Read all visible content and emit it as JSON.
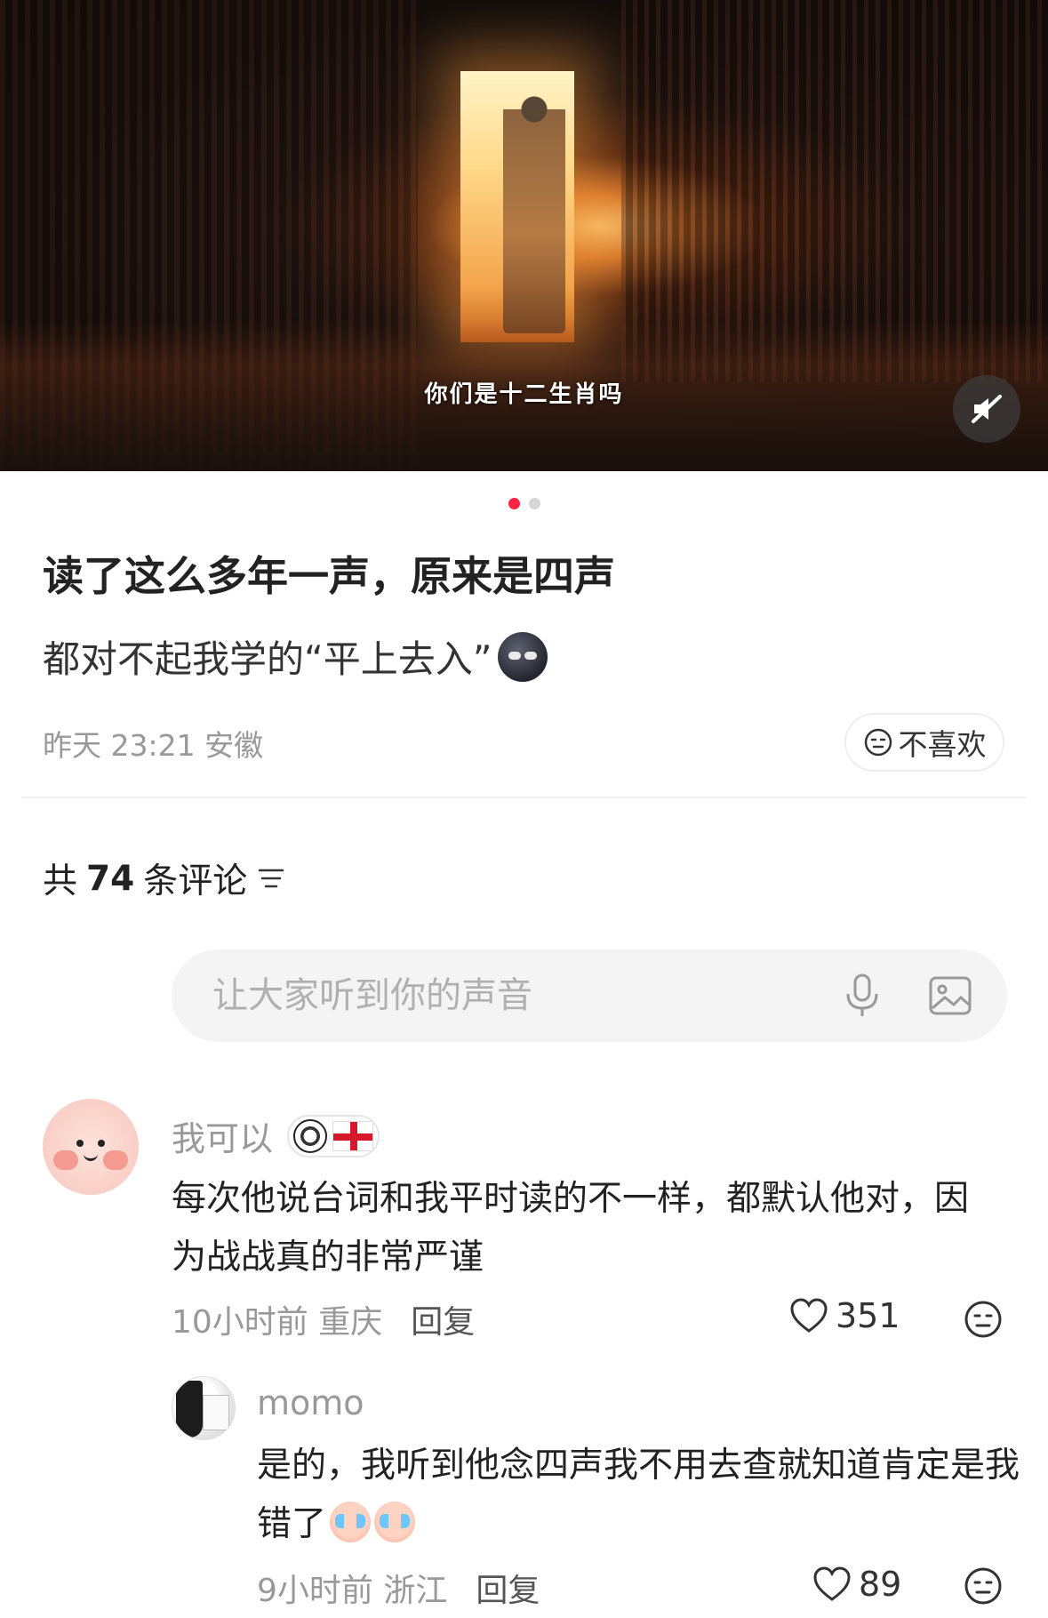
{
  "video": {
    "subtitle": "你们是十二生肖吗",
    "mute_icon": "speaker-muted-icon"
  },
  "carousel": {
    "count": 2,
    "active": 1
  },
  "post": {
    "title": "读了这么多年一声，原来是四声",
    "description": "都对不起我学的“平上去入”",
    "meta": "昨天 23:21 安徽",
    "dislike_label": "不喜欢"
  },
  "comments_header": {
    "prefix": "共",
    "count": "74",
    "suffix": "条评论"
  },
  "comment_input": {
    "placeholder": "让大家听到你的声音"
  },
  "comments": [
    {
      "user": "我可以",
      "text": "每次他说台词和我平时读的不一样，都默认他对，因为战战真的非常严谨",
      "time": "10小时前",
      "location": "重庆",
      "reply_label": "回复",
      "likes": "351"
    },
    {
      "user": "momo",
      "text": "是的，我听到他念四声我不用去查就知道肯定是我错了",
      "time": "9小时前",
      "location": "浙江",
      "reply_label": "回复",
      "likes": "89"
    }
  ],
  "colors": {
    "accent": "#ff2442",
    "muted_text": "#999999",
    "input_bg": "#f4f4f4"
  }
}
